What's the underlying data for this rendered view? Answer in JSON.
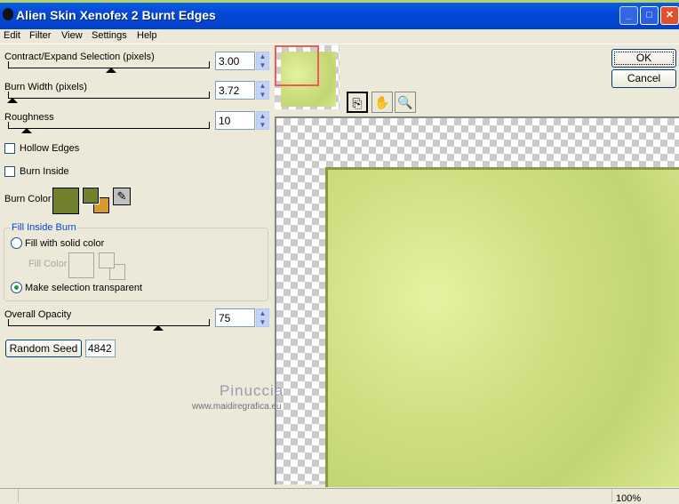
{
  "window": {
    "title": "Alien Skin Xenofex 2 Burnt Edges",
    "minimize": "_",
    "maximize": "□",
    "close": "✕"
  },
  "menu": [
    "Edit",
    "Filter",
    "View",
    "Settings",
    "Help"
  ],
  "controls": {
    "contract": {
      "label": "Contract/Expand Selection (pixels)",
      "value": "3.00",
      "slider_fraction": 0.5
    },
    "burn_width": {
      "label": "Burn Width (pixels)",
      "value": "3.72",
      "slider_fraction": 0.02
    },
    "roughness": {
      "label": "Roughness",
      "value": "10",
      "slider_fraction": 0.09
    },
    "hollow_edges": {
      "label": "Hollow Edges",
      "checked": false
    },
    "burn_inside": {
      "label": "Burn Inside",
      "checked": false
    },
    "burn_color": {
      "label": "Burn Color",
      "color": "#71812d",
      "secondary_color": "#d89a2e"
    },
    "fill_inside": {
      "legend": "Fill Inside Burn",
      "solid": "Fill with solid color",
      "fill_color": "Fill Color",
      "transparent": "Make selection transparent",
      "selected": "transparent"
    },
    "opacity": {
      "label": "Overall Opacity",
      "value": "75",
      "slider_fraction": 0.75
    },
    "random_seed": {
      "label": "Random Seed",
      "value": "4842"
    }
  },
  "buttons": {
    "ok": "OK",
    "cancel": "Cancel"
  },
  "watermark": {
    "name": "Pinuccia",
    "url": "www.maidiregrafica.eu"
  },
  "status": {
    "zoom": "100%"
  }
}
